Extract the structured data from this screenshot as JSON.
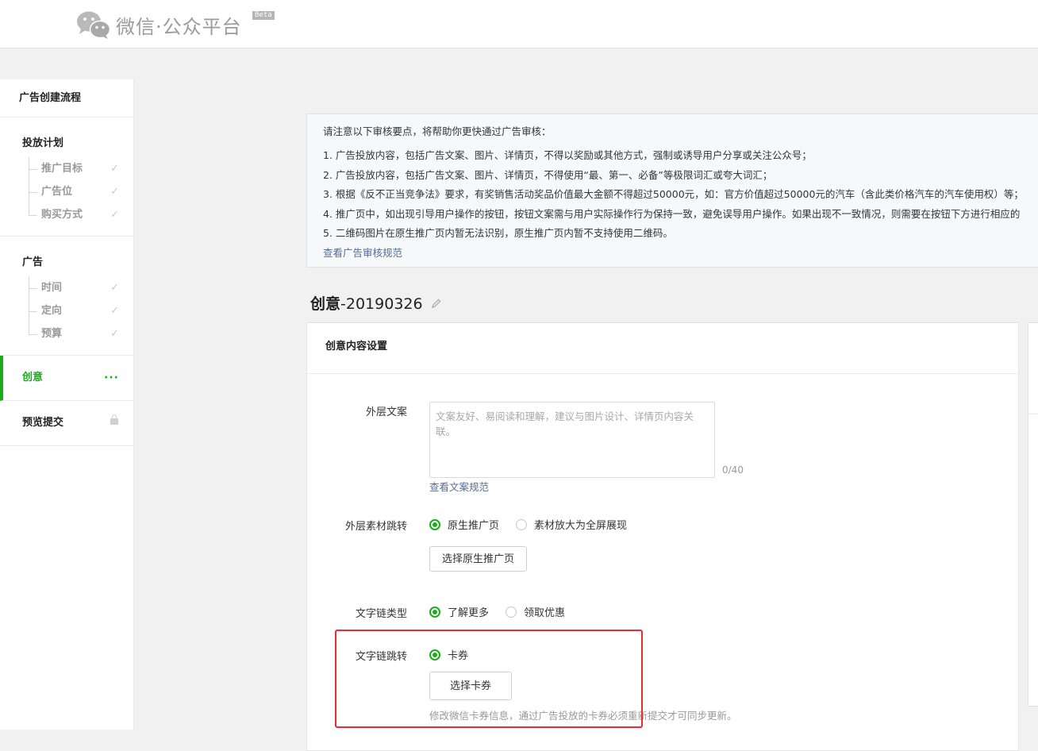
{
  "header": {
    "logo_text": "微信·公众平台",
    "beta": "Beta"
  },
  "sidebar": {
    "title": "广告创建流程",
    "plan": {
      "title": "投放计划",
      "items": [
        "推广目标",
        "广告位",
        "购买方式"
      ]
    },
    "ad": {
      "title": "广告",
      "items": [
        "时间",
        "定向",
        "预算"
      ]
    },
    "creative": {
      "label": "创意",
      "status": "···"
    },
    "submit": {
      "label": "预览提交"
    }
  },
  "notice": {
    "lead": "请注意以下审核要点，将帮助你更快通过广告审核：",
    "items": [
      "1. 广告投放内容，包括广告文案、图片、详情页，不得以奖励或其他方式，强制或诱导用户分享或关注公众号；",
      "2. 广告投放内容，包括广告文案、图片、详情页，不得使用“最、第一、必备”等极限词汇或夸大词汇；",
      "3. 根据《反不正当竞争法》要求，有奖销售活动奖品价值最大金额不得超过50000元，如：官方价值超过50000元的汽车（含此类价格汽车的汽车使用权）等；",
      "4. 推广页中，如出现引导用户操作的按钮，按钮文案需与用户实际操作行为保持一致，避免误导用户操作。如果出现不一致情况，则需要在按钮下方进行相应的",
      "5. 二维码图片在原生推广页内暂无法识别，原生推广页内暂不支持使用二维码。"
    ],
    "link": "查看广告审核规范"
  },
  "creative": {
    "title": "创意",
    "name": "-20190326",
    "section_title": "创意内容设置",
    "outer_copy": {
      "label": "外层文案",
      "placeholder": "文案友好、易阅读和理解，建议与图片设计、详情页内容关联。",
      "value": "",
      "counter": "0/40",
      "link": "查看文案规范"
    },
    "outer_jump": {
      "label": "外层素材跳转",
      "options": [
        "原生推广页",
        "素材放大为全屏展现"
      ],
      "selected": "原生推广页",
      "button": "选择原生推广页"
    },
    "text_link_type": {
      "label": "文字链类型",
      "options": [
        "了解更多",
        "领取优惠"
      ],
      "selected": "了解更多"
    },
    "text_link_jump": {
      "label": "文字链跳转",
      "options": [
        "卡券"
      ],
      "selected": "卡券",
      "button": "选择卡券",
      "hint": "修改微信卡券信息，通过广告投放的卡券必须重新提交才可同步更新。"
    }
  },
  "colors": {
    "accent": "#1aad19",
    "link": "#576b95",
    "highlight": "#e52f2f"
  }
}
